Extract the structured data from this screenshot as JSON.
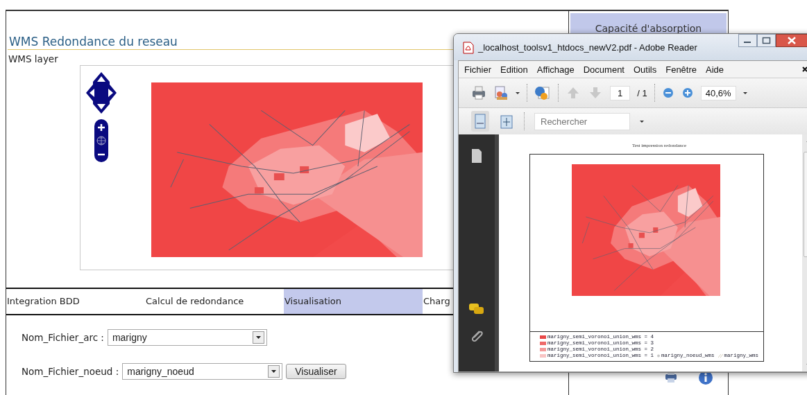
{
  "page": {
    "title": "WMS Redondance du reseau",
    "layer_label": "WMS layer",
    "map": {
      "kind": "picture"
    }
  },
  "tabs": [
    {
      "label": "Integration BDD",
      "selected": false
    },
    {
      "label": "Calcul de redondance",
      "selected": false
    },
    {
      "label": "Visualisation",
      "selected": true
    },
    {
      "label": "Charg",
      "selected": false
    }
  ],
  "form": {
    "fields": [
      {
        "label": "Nom_Fichier_arc :",
        "value": "marigny"
      },
      {
        "label": "Nom_Fichier_noeud :",
        "value": "marigny_noeud",
        "button": "Visualiser"
      }
    ]
  },
  "side_panel": {
    "tab": "Capacité d'absorption"
  },
  "reader": {
    "title": "_localhost_toolsv1_htdocs_newV2.pdf - Adobe Reader",
    "menu": [
      "Fichier",
      "Edition",
      "Affichage",
      "Document",
      "Outils",
      "Fenêtre",
      "Aide"
    ],
    "page_number": "1",
    "page_total": "/ 1",
    "zoom": "40,6%",
    "search_placeholder": "Rechercher",
    "document": {
      "title": "Test impression redondance",
      "map": {
        "kind": "picture"
      },
      "legend": [
        [
          {
            "kind": "fill",
            "color": "#e84848",
            "label": "marigny_semi_voronoi_union_wms = 4"
          }
        ],
        [
          {
            "kind": "fill",
            "color": "#ee6a6a",
            "label": "marigny_semi_voronoi_union_wms = 3"
          }
        ],
        [
          {
            "kind": "fill",
            "color": "#f49a9a",
            "label": "marigny_semi_voronoi_union_wms = 2"
          }
        ],
        [
          {
            "kind": "fill",
            "color": "#f8c4c4",
            "label": "marigny_semi_voronoi_union_wms = 1"
          },
          {
            "kind": "point",
            "color": "#c8c8c8",
            "label": "marigny_noeud_wms"
          },
          {
            "kind": "line",
            "color": "#d8d0c0",
            "label": "marigny_wms"
          }
        ]
      ]
    }
  }
}
